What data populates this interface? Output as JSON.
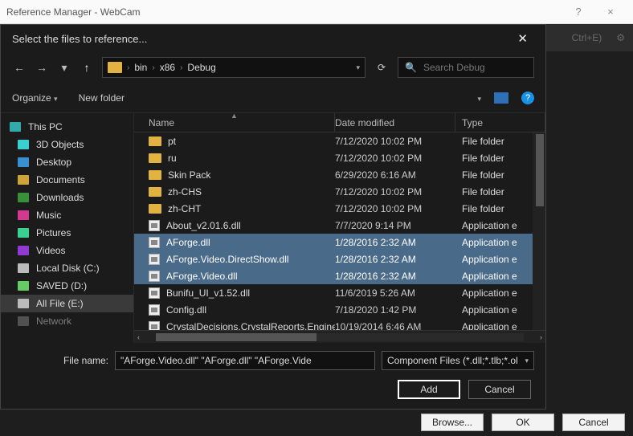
{
  "outer": {
    "title": "Reference Manager - WebCam",
    "help": "?",
    "close": "×",
    "ctrl_hint": "Ctrl+E)"
  },
  "dialog": {
    "title": "Select the files to reference...",
    "close": "✕",
    "breadcrumbs": [
      "bin",
      "x86",
      "Debug"
    ],
    "search_placeholder": "Search Debug",
    "organize": "Organize",
    "new_folder": "New folder",
    "help": "?"
  },
  "sidebar": {
    "items": [
      {
        "label": "This PC",
        "top": true,
        "icon": "pc"
      },
      {
        "label": "3D Objects",
        "icon": "3d"
      },
      {
        "label": "Desktop",
        "icon": "desktop"
      },
      {
        "label": "Documents",
        "icon": "docs"
      },
      {
        "label": "Downloads",
        "icon": "downloads"
      },
      {
        "label": "Music",
        "icon": "music"
      },
      {
        "label": "Pictures",
        "icon": "pictures"
      },
      {
        "label": "Videos",
        "icon": "videos"
      },
      {
        "label": "Local Disk (C:)",
        "icon": "disk"
      },
      {
        "label": "SAVED (D:)",
        "icon": "disk-green"
      },
      {
        "label": "All File (E:)",
        "icon": "disk",
        "selected": true
      },
      {
        "label": "Network",
        "icon": "network",
        "dim": true
      }
    ]
  },
  "columns": {
    "name": "Name",
    "date": "Date modified",
    "type": "Type"
  },
  "rows": [
    {
      "name": "pt",
      "date": "7/12/2020 10:02 PM",
      "type": "File folder",
      "kind": "folder"
    },
    {
      "name": "ru",
      "date": "7/12/2020 10:02 PM",
      "type": "File folder",
      "kind": "folder"
    },
    {
      "name": "Skin Pack",
      "date": "6/29/2020 6:16 AM",
      "type": "File folder",
      "kind": "folder"
    },
    {
      "name": "zh-CHS",
      "date": "7/12/2020 10:02 PM",
      "type": "File folder",
      "kind": "folder"
    },
    {
      "name": "zh-CHT",
      "date": "7/12/2020 10:02 PM",
      "type": "File folder",
      "kind": "folder"
    },
    {
      "name": "About_v2.01.6.dll",
      "date": "7/7/2020 9:14 PM",
      "type": "Application e",
      "kind": "dll"
    },
    {
      "name": "AForge.dll",
      "date": "1/28/2016 2:32 AM",
      "type": "Application e",
      "kind": "dll",
      "selected": true
    },
    {
      "name": "AForge.Video.DirectShow.dll",
      "date": "1/28/2016 2:32 AM",
      "type": "Application e",
      "kind": "dll",
      "selected": true
    },
    {
      "name": "AForge.Video.dll",
      "date": "1/28/2016 2:32 AM",
      "type": "Application e",
      "kind": "dll",
      "selected": true
    },
    {
      "name": "Bunifu_UI_v1.52.dll",
      "date": "11/6/2019 5:26 AM",
      "type": "Application e",
      "kind": "dll"
    },
    {
      "name": "Config.dll",
      "date": "7/18/2020 1:42 PM",
      "type": "Application e",
      "kind": "dll"
    },
    {
      "name": "CrystalDecisions.CrystalReports.Engine.dll",
      "date": "10/19/2014 6:46 AM",
      "type": "Application e",
      "kind": "dll"
    }
  ],
  "footer": {
    "file_name_label": "File name:",
    "file_name_value": "\"AForge.Video.dll\" \"AForge.dll\" \"AForge.Vide",
    "filter": "Component Files (*.dll;*.tlb;*.ol",
    "add": "Add",
    "cancel": "Cancel"
  },
  "bottom": {
    "browse": "Browse...",
    "ok": "OK",
    "cancel": "Cancel"
  }
}
